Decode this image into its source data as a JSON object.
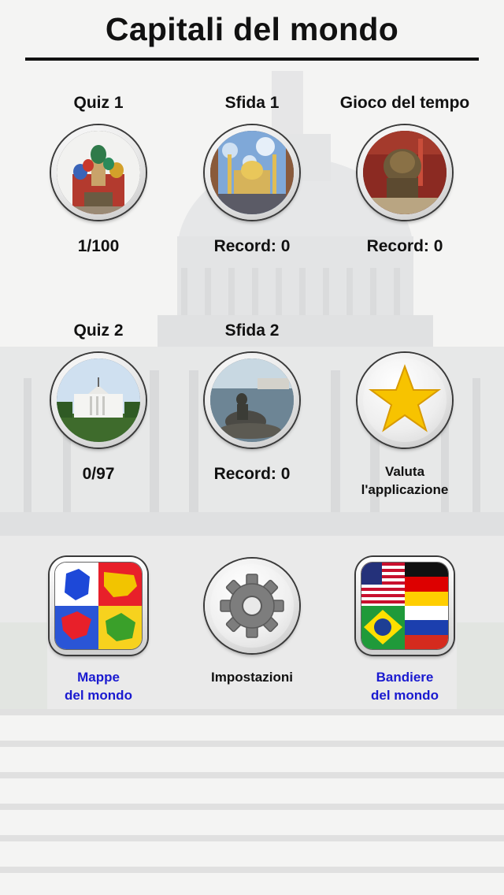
{
  "header": {
    "title": "Capitali del mondo"
  },
  "tiles": [
    {
      "label": "Quiz 1",
      "sub": "1/100",
      "icon": "st-basils-cathedral-icon"
    },
    {
      "label": "Sfida 1",
      "sub": "Record: 0",
      "icon": "mosque-icon"
    },
    {
      "label": "Gioco del tempo",
      "sub": "Record: 0",
      "icon": "lion-statue-icon"
    },
    {
      "label": "Quiz 2",
      "sub": "0/97",
      "icon": "white-house-icon"
    },
    {
      "label": "Sfida 2",
      "sub": "Record: 0",
      "icon": "little-mermaid-icon"
    },
    {
      "label": "",
      "sub_line1": "Valuta",
      "sub_line2": "l'applicazione",
      "icon": "star-icon"
    }
  ],
  "bottom": {
    "maps": {
      "line1": "Mappe",
      "line2": "del mondo",
      "icon": "world-maps-icon"
    },
    "settings": {
      "label": "Impostazioni",
      "icon": "gear-icon"
    },
    "flags": {
      "line1": "Bandiere",
      "line2": "del mondo",
      "icon": "world-flags-icon"
    }
  },
  "colors": {
    "link": "#1a1ad0",
    "star": "#f7c300",
    "text": "#111111"
  }
}
